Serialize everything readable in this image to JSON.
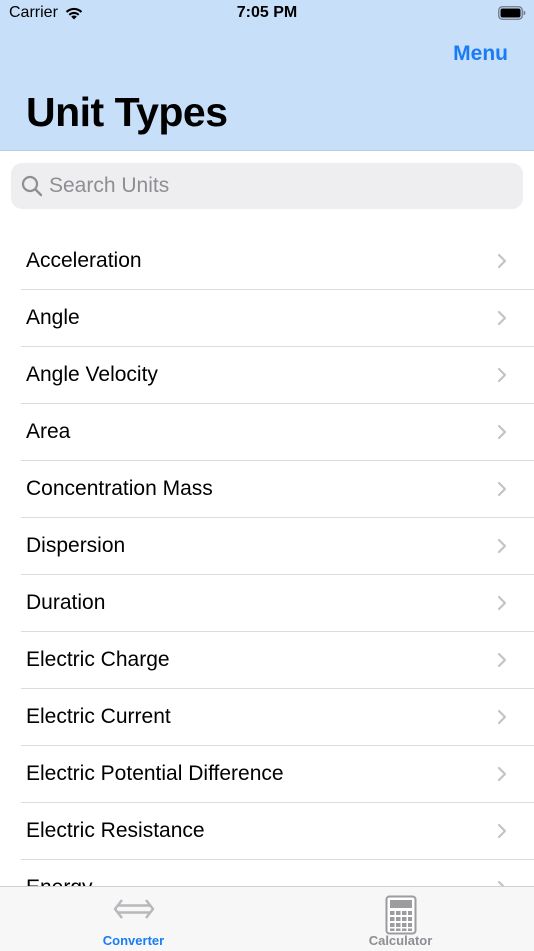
{
  "status_bar": {
    "carrier": "Carrier",
    "time": "7:05 PM"
  },
  "nav": {
    "menu_label": "Menu",
    "title": "Unit Types"
  },
  "search": {
    "placeholder": "Search Units",
    "value": ""
  },
  "unit_types": [
    {
      "label": "Acceleration"
    },
    {
      "label": "Angle"
    },
    {
      "label": "Angle Velocity"
    },
    {
      "label": "Area"
    },
    {
      "label": "Concentration Mass"
    },
    {
      "label": "Dispersion"
    },
    {
      "label": "Duration"
    },
    {
      "label": "Electric Charge"
    },
    {
      "label": "Electric Current"
    },
    {
      "label": "Electric Potential Difference"
    },
    {
      "label": "Electric Resistance"
    },
    {
      "label": "Energy"
    }
  ],
  "tab_bar": {
    "tabs": [
      {
        "label": "Converter",
        "icon": "converter-arrows-icon",
        "selected": true
      },
      {
        "label": "Calculator",
        "icon": "calculator-icon",
        "selected": false
      }
    ]
  },
  "colors": {
    "nav_background": "#c7dff8",
    "accent": "#1a7cf4",
    "inactive_tab": "#8e8e93",
    "search_background": "#eeeef0"
  }
}
